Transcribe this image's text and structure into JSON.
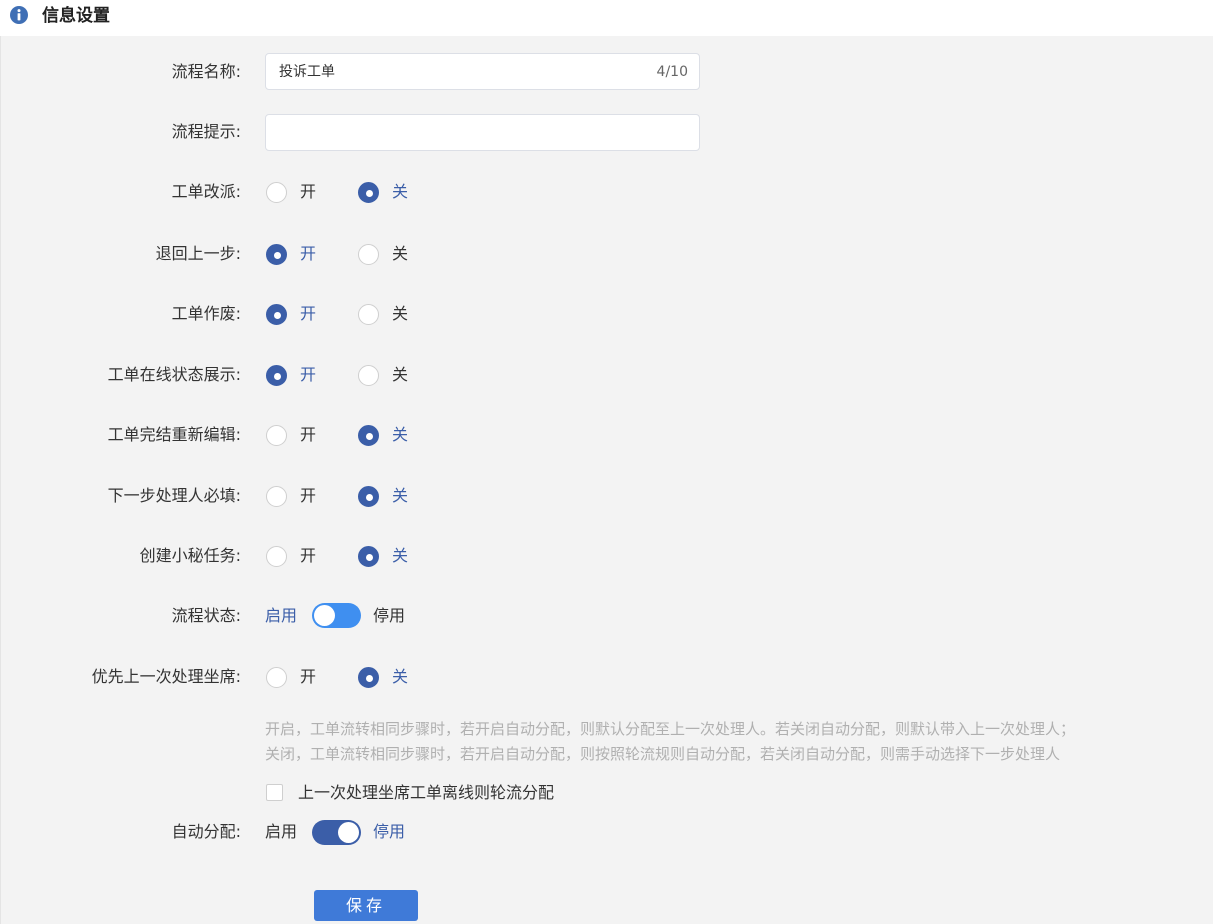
{
  "header": {
    "title": "信息设置",
    "icon": "info-icon"
  },
  "form": {
    "process_name": {
      "label": "流程名称:",
      "value": "投诉工单",
      "counter": "4/10"
    },
    "process_hint": {
      "label": "流程提示:",
      "value": ""
    },
    "options": {
      "on": "开",
      "off": "关"
    },
    "radio_rows": [
      {
        "label": "工单改派:",
        "selected": "关"
      },
      {
        "label": "退回上一步:",
        "selected": "开"
      },
      {
        "label": "工单作废:",
        "selected": "开"
      },
      {
        "label": "工单在线状态展示:",
        "selected": "开"
      },
      {
        "label": "工单完结重新编辑:",
        "selected": "关"
      },
      {
        "label": "下一步处理人必填:",
        "selected": "关"
      },
      {
        "label": "创建小秘任务:",
        "selected": "关"
      }
    ],
    "process_status": {
      "label": "流程状态:",
      "enable": "启用",
      "disable": "停用",
      "state": "启用"
    },
    "priority_agent": {
      "label": "优先上一次处理坐席:",
      "selected": "关"
    },
    "help_lines": [
      "开启，工单流转相同步骤时，若开启自动分配，则默认分配至上一次处理人。若关闭自动分配，则默认带入上一次处理人；",
      "关闭，工单流转相同步骤时，若开启自动分配，则按照轮流规则自动分配，若关闭自动分配，则需手动选择下一步处理人"
    ],
    "offline_rotate": {
      "label": "上一次处理坐席工单离线则轮流分配",
      "checked": false
    },
    "auto_assign": {
      "label": "自动分配:",
      "enable": "启用",
      "disable": "停用",
      "state": "停用"
    },
    "save_label": "保存"
  },
  "colors": {
    "accent": "#3b5ea8",
    "switch_light": "#3f8ff0",
    "button": "#3f7ad8",
    "help_text": "#b0b0b0"
  }
}
